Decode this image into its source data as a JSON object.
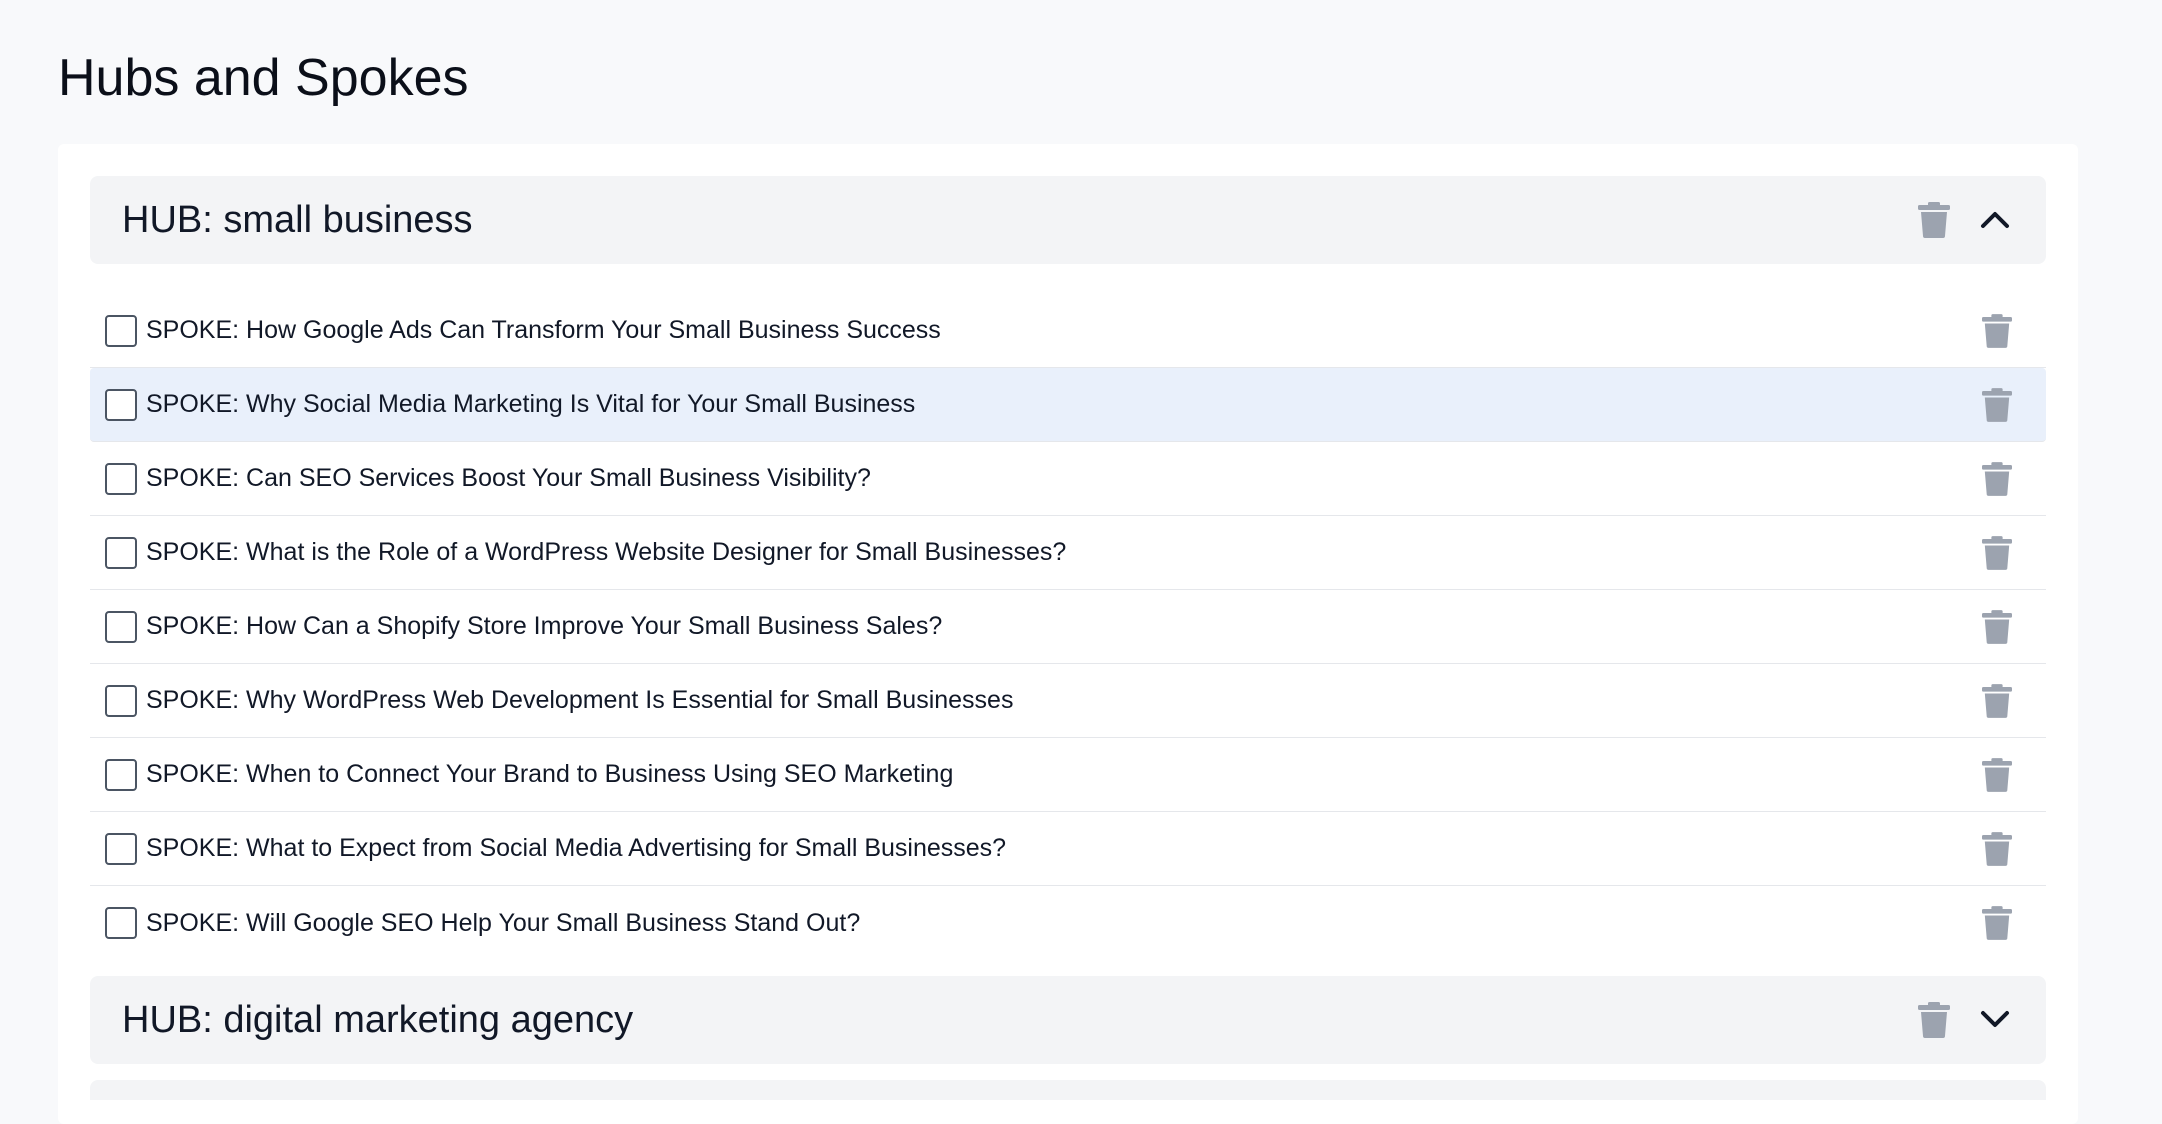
{
  "page": {
    "title": "Hubs and Spokes"
  },
  "hubs": [
    {
      "title": "HUB: small business",
      "expanded": true,
      "spokes": [
        {
          "label": "SPOKE: How Google Ads Can Transform Your Small Business Success",
          "checked": false,
          "highlighted": false
        },
        {
          "label": "SPOKE: Why Social Media Marketing Is Vital for Your Small Business",
          "checked": false,
          "highlighted": true
        },
        {
          "label": "SPOKE: Can SEO Services Boost Your Small Business Visibility?",
          "checked": false,
          "highlighted": false
        },
        {
          "label": "SPOKE: What is the Role of a WordPress Website Designer for Small Businesses?",
          "checked": false,
          "highlighted": false
        },
        {
          "label": "SPOKE: How Can a Shopify Store Improve Your Small Business Sales?",
          "checked": false,
          "highlighted": false
        },
        {
          "label": "SPOKE: Why WordPress Web Development Is Essential for Small Businesses",
          "checked": false,
          "highlighted": false
        },
        {
          "label": "SPOKE: When to Connect Your Brand to Business Using SEO Marketing",
          "checked": false,
          "highlighted": false
        },
        {
          "label": "SPOKE: What to Expect from Social Media Advertising for Small Businesses?",
          "checked": false,
          "highlighted": false
        },
        {
          "label": "SPOKE: Will Google SEO Help Your Small Business Stand Out?",
          "checked": false,
          "highlighted": false
        }
      ]
    },
    {
      "title": "HUB: digital marketing agency",
      "expanded": false,
      "spokes": []
    }
  ],
  "icons": {
    "delete": "trash-icon",
    "collapse": "chevron-up-icon",
    "expand": "chevron-down-icon"
  },
  "colors": {
    "hub_header_bg": "#f3f4f6",
    "highlight_row_bg": "#e9f0fb",
    "trash_icon": "#9ca3af",
    "chevron": "#111827"
  }
}
